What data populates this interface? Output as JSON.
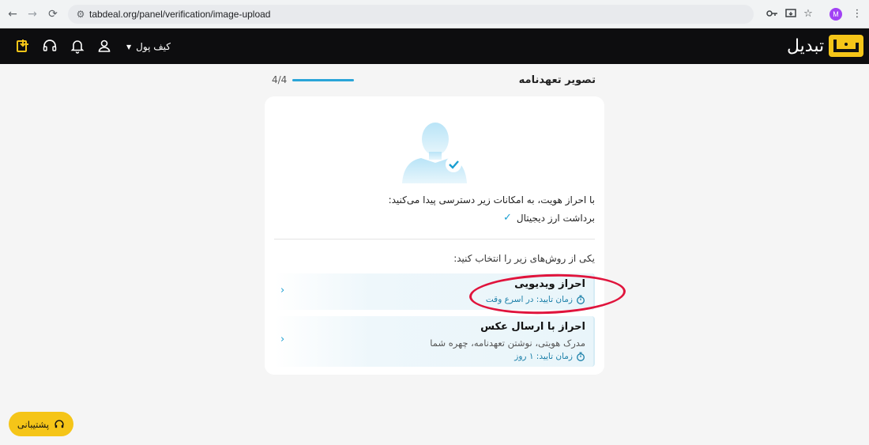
{
  "browser": {
    "url": "tabdeal.org/panel/verification/image-upload",
    "profile_initial": "M"
  },
  "header": {
    "brand_name": "تبدیل",
    "wallet_label": "کیف پول",
    "icons": [
      "deposit-icon",
      "headset-icon",
      "bell-icon",
      "user-icon"
    ]
  },
  "progress": {
    "title": "تصویر تعهدنامه",
    "count": "4/4",
    "fraction": 1.0
  },
  "card": {
    "benefits_title": "با احراز هویت، به امکانات زیر دسترسی پیدا می‌کنید:",
    "benefits": [
      "برداشت ارز دیجیتال"
    ],
    "choose_label": "یکی از روش‌های زیر را انتخاب کنید:",
    "methods": [
      {
        "title": "احراز ویدیویی",
        "description": "",
        "time": "زمان تایید: در اسرع وقت"
      },
      {
        "title": "احراز با ارسال عکس",
        "description": "مدرک هویتی، نوشتن تعهدنامه، چهره شما",
        "time": "زمان تایید: ۱ روز"
      }
    ]
  },
  "support_button": "پشتیبانی",
  "colors": {
    "accent_blue": "#2aa5d8",
    "brand_yellow": "#f5c518",
    "header_bg": "#0d0d0f",
    "highlight_red": "#e0143c"
  }
}
